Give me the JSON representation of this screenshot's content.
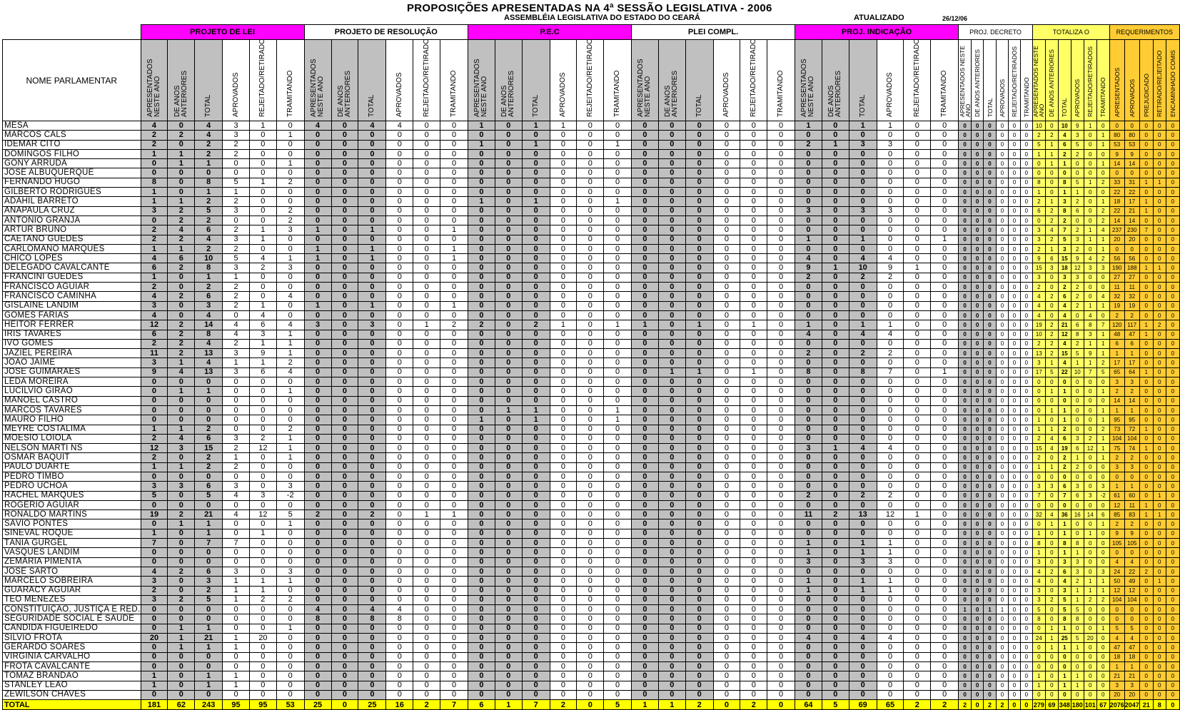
{
  "title": "PROPOSIÇÕES APRESENTADAS NA 4ª SESSÃO LEGISLATIVA - 2006",
  "subtitle": "ASSEMBLÉIA LEGISLATIVA DO ESTADO DO CEARÁ",
  "updated_label": "ATUALIZADO",
  "updated_date": "26/12/06",
  "name_header": "NOME PARLAMENTAR",
  "groups": [
    "PROJETO DE LEI",
    "PROJETO DE RESOLUÇÃO",
    "P.E.C",
    "PLEI COMPL.",
    "PROJ. INDICAÇÃO",
    "PROJ. DECRETO",
    "TOTALIZA    O",
    "REQUERIMENTOS"
  ],
  "subheaders": [
    "APRESENTADOS NESTE ANO",
    "DE ANOS ANTERIORES",
    "TOTAL",
    "APROVADOS",
    "REJEITADO/RETIRADOS",
    "TRAMITANDO"
  ],
  "req_subheaders": [
    "APRESENTADOS",
    "APROVADOS",
    "PREJUDICADO",
    "RETIRADO/REJEITADO",
    "ENCAMINHADO COMIS"
  ],
  "colors": {
    "magenta": "#ff00ff",
    "gray": "#c0c0c0",
    "yellow": "#ffff66",
    "orange": "#ffcc33",
    "total_row": "#ffff00"
  },
  "rows": [
    [
      "MESA",
      "4 0 4 3 1 0",
      "4 0 4 4 0 0",
      "1 0 1 1 0 0",
      "0 0 0 0 0 0",
      "1 0 1 1 0 0",
      "0 0 0 0 0 0",
      "10 0 10 9 1 0",
      "0 0 0 0 0"
    ],
    [
      "MARCOS CALS",
      "2 2 4 3 0 1",
      "0 0 0 0 0 0",
      "0 0 0 0 0 0",
      "0 0 0 0 0 0",
      "0 0 0 0 0 0",
      "0 0 0 0 0 0",
      "2 2 4 3 0 1",
      "80 80 0 0 0"
    ],
    [
      "IDEMAR CITÓ",
      "2 0 2 2 0 0",
      "0 0 0 0 0 0",
      "1 0 1 0 0 1",
      "0 0 0 0 0 0",
      "2 1 3 3 0 0",
      "0 0 0 0 0 0",
      "5 1 6 5 0 1",
      "53 53 0 0 0"
    ],
    [
      "DOMINGOS FILHO",
      "1 1 2 2 0 0",
      "0 0 0 0 0 0",
      "0 0 0 0 0 0",
      "0 0 0 0 0 0",
      "0 0 0 0 0 0",
      "0 0 0 0 0 0",
      "1 1 2 2 0 0",
      "9 9 0 0 0"
    ],
    [
      "GONY ARRUDA",
      "0 1 1 0 0 1",
      "0 0 0 0 0 0",
      "0 0 0 0 0 0",
      "0 0 0 0 0 0",
      "0 0 0 0 0 0",
      "0 0 0 0 0 0",
      "0 1 1 0 0 1",
      "14 14 0 0 0"
    ],
    [
      "JOSÉ ALBUQUERQUE",
      "0 0 0 0 0 0",
      "0 0 0 0 0 0",
      "0 0 0 0 0 0",
      "0 0 0 0 0 0",
      "0 0 0 0 0 0",
      "0 0 0 0 0 0",
      "0 0 0 0 0 0",
      "0 0 0 0 0"
    ],
    [
      "FERNANDO HUGO",
      "8 0 8 5 1 2",
      "0 0 0 0 0 0",
      "0 0 0 0 0 0",
      "0 0 0 0 0 0",
      "0 0 0 0 0 0",
      "0 0 0 0 0 0",
      "8 0 8 5 1 2",
      "33 31 1 1 0"
    ],
    [
      "GILBERTO RODRIGUES",
      "1 0 1 1 0 0",
      "0 0 0 0 0 0",
      "0 0 0 0 0 0",
      "0 0 0 0 0 0",
      "0 0 0 0 0 0",
      "0 0 0 0 0 0",
      "1 0 1 1 0 0",
      "22 22 0 0 0"
    ],
    [
      "ADAHIL BARRETO",
      "1 1 2 2 0 0",
      "0 0 0 0 0 0",
      "1 0 1 0 0 1",
      "0 0 0 0 0 0",
      "0 0 0 0 0 0",
      "0 0 0 0 0 0",
      "2 1 3 2 0 1",
      "18 17 1 0 0"
    ],
    [
      "ANAPAULA CRUZ",
      "3 2 5 3 0 2",
      "0 0 0 0 0 0",
      "0 0 0 0 0 0",
      "0 0 0 0 0 0",
      "3 0 3 3 0 0",
      "0 0 0 0 0 0",
      "6 2 8 6 0 2",
      "22 21 1 0 0"
    ],
    [
      "ANTÔNIO GRANJA",
      "0 2 2 0 0 2",
      "0 0 0 0 0 0",
      "0 0 0 0 0 0",
      "0 0 0 0 0 0",
      "0 0 0 0 0 0",
      "0 0 0 0 0 0",
      "0 2 2 0 0 2",
      "14 14 0 0 0"
    ],
    [
      "ARTUR BRUNO",
      "2 4 6 2 1 3",
      "1 0 1 0 0 1",
      "0 0 0 0 0 0",
      "0 0 0 0 0 0",
      "0 0 0 0 0 0",
      "0 0 0 0 0 0",
      "3 4 7 2 1 4",
      "237 230 7 0 0"
    ],
    [
      "CAETANO GUEDES",
      "2 2 4 3 1 0",
      "0 0 0 0 0 0",
      "0 0 0 0 0 0",
      "0 0 0 0 0 0",
      "1 0 1 0 0 1",
      "0 0 0 0 0 0",
      "3 2 5 3 1 1",
      "20 20 0 0 0"
    ],
    [
      "CARLOMANO MARQUES",
      "1 1 2 2 0 0",
      "1 0 1 0 0 1",
      "0 0 0 0 0 0",
      "0 0 0 0 0 0",
      "0 0 0 0 0 0",
      "0 0 0 0 0 0",
      "2 1 3 2 0 1",
      "0 0 0 0 0"
    ],
    [
      "CHICO LOPES",
      "4 6 10 5 4 1",
      "1 0 1 0 0 1",
      "0 0 0 0 0 0",
      "0 0 0 0 0 0",
      "4 0 4 4 0 0",
      "0 0 0 0 0 0",
      "9 6 15 9 4 2",
      "56 56 0 0 0"
    ],
    [
      "DELEGADO CAVALCANTE",
      "6 2 8 3 2 3",
      "0 0 0 0 0 0",
      "0 0 0 0 0 0",
      "0 0 0 0 0 0",
      "9 1 10 9 1 0",
      "0 0 0 0 0 0",
      "15 3 18 12 3 3",
      "190 188 1 1 0"
    ],
    [
      "FRANCINI GUEDES",
      "1 0 1 1 0 0",
      "0 0 0 0 0 0",
      "0 0 0 0 0 0",
      "0 0 0 0 0 0",
      "2 0 2 2 0 0",
      "0 0 0 0 0 0",
      "3 0 3 3 0 0",
      "27 27 0 0 0"
    ],
    [
      "FRANCISCO AGUIAR",
      "2 0 2 2 0 0",
      "0 0 0 0 0 0",
      "0 0 0 0 0 0",
      "0 0 0 0 0 0",
      "0 0 0 0 0 0",
      "0 0 0 0 0 0",
      "2 0 2 2 0 0",
      "11 11 0 0 0"
    ],
    [
      "FRANCISCO CAMINHA",
      "4 2 6 2 0 4",
      "0 0 0 0 0 0",
      "0 0 0 0 0 0",
      "0 0 0 0 0 0",
      "0 0 0 0 0 0",
      "0 0 0 0 0 0",
      "4 2 6 2 0 4",
      "32 32 0 0 0"
    ],
    [
      "GISLAINE LANDIM",
      "3 0 3 2 1 0",
      "1 0 1 0 0 1",
      "0 0 0 0 0 0",
      "0 0 0 0 0 0",
      "0 0 0 0 0 0",
      "0 0 0 0 0 0",
      "4 0 4 2 1 1",
      "19 19 0 0 0"
    ],
    [
      "GOMES FARIAS",
      "4 0 4 0 4 0",
      "0 0 0 0 0 0",
      "0 0 0 0 0 0",
      "0 0 0 0 0 0",
      "0 0 0 0 0 0",
      "0 0 0 0 0 0",
      "4 0 4 0 4 0",
      "2 2 0 0 0"
    ],
    [
      "HEITOR FERRER",
      "12 2 14 4 6 4",
      "3 0 3 0 1 2",
      "2 0 2 1 0 1",
      "1 0 1 0 1 0",
      "1 0 1 1 0 0",
      "0 0 0 0 0 0",
      "19 2 21 6 8 7",
      "120 117 1 2 0"
    ],
    [
      "IRIS TAVARES",
      "6 2 8 4 3 1",
      "0 0 0 0 0 0",
      "0 0 0 0 0 0",
      "0 0 0 0 0 0",
      "4 0 4 4 0 0",
      "0 0 0 0 0 0",
      "10 2 12 8 3 1",
      "48 47 1 0 0"
    ],
    [
      "IVO GOMES",
      "2 2 4 2 1 1",
      "0 0 0 0 0 0",
      "0 0 0 0 0 0",
      "0 0 0 0 0 0",
      "0 0 0 0 0 0",
      "0 0 0 0 0 0",
      "2 2 4 2 1 1",
      "6 6 0 0 0"
    ],
    [
      "JAZIEL PEREIRA",
      "11 2 13 3 9 1",
      "0 0 0 0 0 0",
      "0 0 0 0 0 0",
      "0 0 0 0 0 0",
      "2 0 2 2 0 0",
      "0 0 0 0 0 0",
      "13 2 15 5 9 1",
      "1 1 0 0 0"
    ],
    [
      "JOÃO JAIME",
      "3 1 4 1 1 2",
      "0 0 0 0 0 0",
      "0 0 0 0 0 0",
      "0 0 0 0 0 0",
      "0 0 0 0 0 0",
      "0 0 0 0 0 0",
      "3 1 4 1 1 2",
      "17 17 0 0 0"
    ],
    [
      "JOSÉ GUIMARÃES",
      "9 4 13 3 6 4",
      "0 0 0 0 0 0",
      "0 0 0 0 0 0",
      "0 1 1 0 1 0",
      "8 0 8 7 0 1",
      "0 0 0 0 0 0",
      "17 5 22 10 7 5",
      "65 64 1 0 0"
    ],
    [
      "LEDA MOREIRA",
      "0 0 0 0 0 0",
      "0 0 0 0 0 0",
      "0 0 0 0 0 0",
      "0 0 0 0 0 0",
      "0 0 0 0 0 0",
      "0 0 0 0 0 0",
      "0 0 0 0 0 0",
      "3 3 0 0 0"
    ],
    [
      "LUCILVIO GIRÃO",
      "0 1 1 0 0 1",
      "0 0 0 0 0 0",
      "0 0 0 0 0 0",
      "0 0 0 0 0 0",
      "0 0 0 0 0 0",
      "0 0 0 0 0 0",
      "0 1 1 0 0 1",
      "2 2 0 0 0"
    ],
    [
      "MANOEL CASTRO",
      "0 0 0 0 0 0",
      "0 0 0 0 0 0",
      "0 0 0 0 0 0",
      "0 0 0 0 0 0",
      "0 0 0 0 0 0",
      "0 0 0 0 0 0",
      "0 0 0 0 0 0",
      "14 14 0 0 0"
    ],
    [
      "MARCOS TAVARES",
      "0 0 0 0 0 0",
      "0 0 0 0 0 0",
      "0 1 1 0 0 1",
      "0 0 0 0 0 0",
      "0 0 0 0 0 0",
      "0 0 0 0 0 0",
      "0 1 1 0 0 1",
      "1 1 0 0 0"
    ],
    [
      "MAURO FILHO",
      "0 0 0 0 0 0",
      "0 0 0 0 0 0",
      "1 0 1 0 0 1",
      "0 0 0 0 0 0",
      "0 0 0 0 0 0",
      "0 0 0 0 0 0",
      "1 0 1 0 0 1",
      "95 95 0 0 0"
    ],
    [
      "MEYRE COSTALIMA",
      "1 1 2 0 0 2",
      "0 0 0 0 0 0",
      "0 0 0 0 0 0",
      "0 0 0 0 0 0",
      "0 0 0 0 0 0",
      "0 0 0 0 0 0",
      "1 1 2 0 0 2",
      "73 72 1 0 0"
    ],
    [
      "MOÉSIO LOIOLA",
      "2 4 6 3 2 1",
      "0 0 0 0 0 0",
      "0 0 0 0 0 0",
      "0 0 0 0 0 0",
      "0 0 0 0 0 0",
      "0 0 0 0 0 0",
      "2 4 6 3 2 1",
      "104 104 0 0 0"
    ],
    [
      "NELSON MARTI NS",
      "12 3 15 2 12 1",
      "0 0 0 0 0 0",
      "0 0 0 0 0 0",
      "0 0 0 0 0 0",
      "3 1 4 4 0 0",
      "0 0 0 0 0 0",
      "15 4 19 6 12 1",
      "75 74 1 0 0"
    ],
    [
      "OSMAR BAQUIT",
      "2 0 2 1 0 1",
      "0 0 0 0 0 0",
      "0 0 0 0 0 0",
      "0 0 0 0 0 0",
      "0 0 0 0 0 0",
      "0 0 0 0 0 0",
      "2 0 2 1 0 1",
      "2 2 0 0 0"
    ],
    [
      "PAULO DUARTE",
      "1 1 2 2 0 0",
      "0 0 0 0 0 0",
      "0 0 0 0 0 0",
      "0 0 0 0 0 0",
      "0 0 0 0 0 0",
      "0 0 0 0 0 0",
      "1 1 2 2 0 0",
      "3 3 0 0 0"
    ],
    [
      "PEDRO TIMBÓ",
      "0 0 0 0 0 0",
      "0 0 0 0 0 0",
      "0 0 0 0 0 0",
      "0 0 0 0 0 0",
      "0 0 0 0 0 0",
      "0 0 0 0 0 0",
      "0 0 0 0 0 0",
      "0 0 0 0 0"
    ],
    [
      "PEDRO UCHOA",
      "3 3 6 3 0 3",
      "0 0 0 0 0 0",
      "0 0 0 0 0 0",
      "0 0 0 0 0 0",
      "0 0 0 0 0 0",
      "0 0 0 0 0 0",
      "3 3 6 3 0 3",
      "1 1 0 0 0"
    ],
    [
      "RACHEL MARQUES",
      "5 0 5 4 3 -2",
      "0 0 0 0 0 0",
      "0 0 0 0 0 0",
      "0 0 0 0 0 0",
      "2 0 2 2 0 0",
      "0 0 0 0 0 0",
      "7 0 7 6 3 -2",
      "61 60 0 1 0"
    ],
    [
      "ROGÉRIO AGUIAR",
      "0 0 0 0 0 0",
      "0 0 0 0 0 0",
      "0 0 0 0 0 0",
      "0 0 0 0 0 0",
      "0 0 0 0 0 0",
      "0 0 0 0 0 0",
      "0 0 0 0 0 0",
      "12 11 1 0 0"
    ],
    [
      "RONALDO MARTINS",
      "19 2 21 4 12 5",
      "2 0 2 0 1 1",
      "0 0 0 0 0 0",
      "0 0 0 0 0 0",
      "11 2 13 12 1 0",
      "0 0 0 0 0 0",
      "32 4 36 16 14 6",
      "85 83 1 1 0"
    ],
    [
      "SÁVIO PONTES",
      "0 1 1 0 0 1",
      "0 0 0 0 0 0",
      "0 0 0 0 0 0",
      "0 0 0 0 0 0",
      "0 0 0 0 0 0",
      "0 0 0 0 0 0",
      "0 1 1 0 0 1",
      "2 2 0 0 0"
    ],
    [
      "SINEVAL ROQUE",
      "1 0 1 0 1 0",
      "0 0 0 0 0 0",
      "0 0 0 0 0 0",
      "0 0 0 0 0 0",
      "0 0 0 0 0 0",
      "0 0 0 0 0 0",
      "1 0 1 0 1 0",
      "9 9 0 0 0"
    ],
    [
      "TÂNIA GURGEL",
      "7 0 7 7 0 0",
      "0 0 0 0 0 0",
      "0 0 0 0 0 0",
      "0 0 0 0 0 0",
      "1 0 1 1 0 0",
      "0 0 0 0 0 0",
      "8 0 8 8 0 0",
      "105 105 0 0 0"
    ],
    [
      "VASQUES LANDIM",
      "0 0 0 0 0 0",
      "0 0 0 0 0 0",
      "0 0 0 0 0 0",
      "0 0 0 0 0 0",
      "1 0 1 1 0 0",
      "0 0 0 0 0 0",
      "1 0 1 1 0 0",
      "0 0 0 0 0"
    ],
    [
      "ZEMARIA PIMENTA",
      "0 0 0 0 0 0",
      "0 0 0 0 0 0",
      "0 0 0 0 0 0",
      "0 0 0 0 0 0",
      "3 0 3 3 0 0",
      "0 0 0 0 0 0",
      "3 0 3 3 0 0",
      "4 4 0 0 0"
    ],
    [
      "JOSÉ SARTO",
      "4 2 6 3 0 3",
      "0 0 0 0 0 0",
      "0 0 0 0 0 0",
      "0 0 0 0 0 0",
      "0 0 0 0 0 0",
      "0 0 0 0 0 0",
      "4 2 6 3 0 3",
      "24 22 2 0 0"
    ],
    [
      "MARCELO SOBREIRA",
      "3 0 3 1 1 1",
      "0 0 0 0 0 0",
      "0 0 0 0 0 0",
      "0 0 0 0 0 0",
      "1 0 1 1 0 0",
      "0 0 0 0 0 0",
      "4 0 4 2 1 1",
      "50 49 0 1 0"
    ],
    [
      "GUARACY AGUIAR",
      "2 0 2 1 1 0",
      "0 0 0 0 0 0",
      "0 0 0 0 0 0",
      "0 0 0 0 0 0",
      "1 0 1 1 0 0",
      "0 0 0 0 0 0",
      "3 0 3 1 1 1",
      "12 12 0 0 0"
    ],
    [
      "TEO MENEZES",
      "3 2 5 1 2 2",
      "0 0 0 0 0 0",
      "0 0 0 0 0 0",
      "0 0 0 0 0 0",
      "0 0 0 0 0 0",
      "0 0 0 0 0 0",
      "3 2 5 1 2 2",
      "104 104 0 0 0"
    ],
    [
      "CONSTITUIÇÃO, JUSTIÇA E RED.",
      "0 0 0 0 0 0",
      "4 0 4 4 0 0",
      "0 0 0 0 0 0",
      "0 0 0 0 0 0",
      "0 0 0 0 0 0",
      "1 0 1 1 0 0",
      "5 0 5 5 0 0",
      "0 0 0 0 0"
    ],
    [
      "SEGURIDADE SOCIAL E SAÚDE",
      "0 0 0 0 0 0",
      "8 0 8 8 0 0",
      "0 0 0 0 0 0",
      "0 0 0 0 0 0",
      "0 0 0 0 0 0",
      "0 0 0 0 0 0",
      "8 0 8 8 0 0",
      "0 0 0 0 0"
    ],
    [
      "CÂNDIDA FIGUEIREDO",
      "0 1 1 0 0 1",
      "0 0 0 0 0 0",
      "0 0 0 0 0 0",
      "0 0 0 0 0 0",
      "0 0 0 0 0 0",
      "0 0 0 0 0 0",
      "0 1 1 0 0 1",
      "5 5 0 0 0"
    ],
    [
      "SILVIO FROTA",
      "20 1 21 1 20 0",
      "0 0 0 0 0 0",
      "0 0 0 0 0 0",
      "0 0 0 0 0 0",
      "4 0 4 4 0 0",
      "0 0 0 0 0 0",
      "24 1 25 5 20 0",
      "4 4 0 0 0"
    ],
    [
      "GERARDO SOARES",
      "0 1 1 1 0 0",
      "0 0 0 0 0 0",
      "0 0 0 0 0 0",
      "0 0 0 0 0 0",
      "0 0 0 0 0 0",
      "0 0 0 0 0 0",
      "0 1 1 1 0 0",
      "47 47 0 0 0"
    ],
    [
      "VIRGINIA CARVALHO",
      "0 0 0 0 0 0",
      "0 0 0 0 0 0",
      "0 0 0 0 0 0",
      "0 0 0 0 0 0",
      "0 0 0 0 0 0",
      "0 0 0 0 0 0",
      "0 0 0 0 0 0",
      "18 18 0 0 0"
    ],
    [
      "FROTA CAVALCANTE",
      "0 0 0 0 0 0",
      "0 0 0 0 0 0",
      "0 0 0 0 0 0",
      "0 0 0 0 0 0",
      "0 0 0 0 0 0",
      "0 0 0 0 0 0",
      "0 0 0 0 0 0",
      "1 1 0 0 0"
    ],
    [
      "TOMAZ BRANDÃO",
      "1 0 1 1 0 0",
      "0 0 0 0 0 0",
      "0 0 0 0 0 0",
      "0 0 0 0 0 0",
      "0 0 0 0 0 0",
      "0 0 0 0 0 0",
      "1 0 1 1 0 0",
      "21 21 0 0 0"
    ],
    [
      "STANLEY LEÃO",
      "1 0 1 1 0 0",
      "0 0 0 0 0 0",
      "0 0 0 0 0 0",
      "0 0 0 0 0 0",
      "0 0 0 0 0 0",
      "0 0 0 0 0 0",
      "1 0 1 1 0 0",
      "3 3 0 0 0"
    ],
    [
      "ZEWILSON CHAVES",
      "0 0 0 0 0 0",
      "0 0 0 0 0 0",
      "0 0 0 0 0 0",
      "0 0 0 0 0 0",
      "0 0 0 0 0 0",
      "0 0 0 0 0 0",
      "0 0 0 0 0 0",
      "20 20 0 0 0"
    ]
  ],
  "total_row": [
    "TOTAL",
    "181 62 243 95 95 53",
    "25 0 25 16 2 7",
    "6 1 7 2 0 5",
    "1 1 2 0 2 0",
    "64 5 69 65 2 2",
    "2 0 2 2 0 0",
    "279 69 348 180 101 67",
    "2076 2047 21 8 0"
  ]
}
